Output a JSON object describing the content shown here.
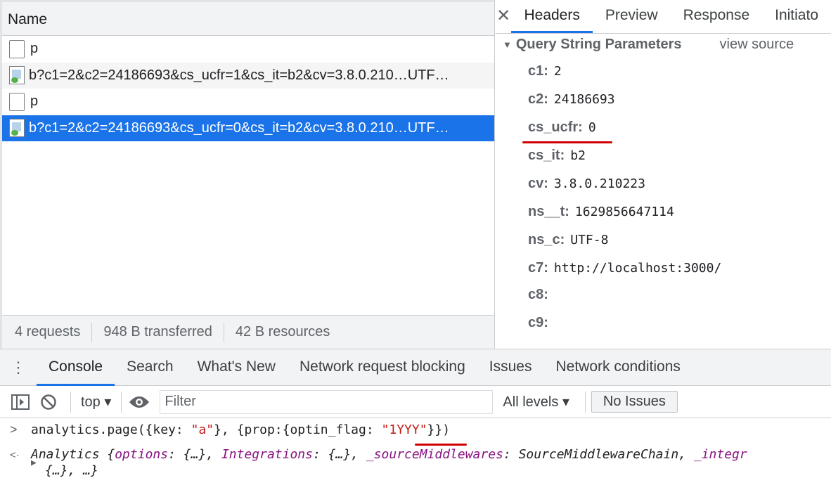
{
  "network": {
    "name_header": "Name",
    "requests": [
      {
        "name": "p",
        "type": "document"
      },
      {
        "name": "b?c1=2&c2=24186693&cs_ucfr=1&cs_it=b2&cv=3.8.0.210…UTF…",
        "type": "image"
      },
      {
        "name": "p",
        "type": "document"
      },
      {
        "name": "b?c1=2&c2=24186693&cs_ucfr=0&cs_it=b2&cv=3.8.0.210…UTF…",
        "type": "image",
        "selected": true
      }
    ],
    "status": {
      "requests": "4 requests",
      "transferred": "948 B transferred",
      "resources": "42 B resources"
    }
  },
  "details": {
    "close_icon": "close-icon",
    "tabs": [
      "Headers",
      "Preview",
      "Response",
      "Initiato"
    ],
    "active_tab": "Headers",
    "section_title": "Query String Parameters",
    "view_source": "view source",
    "params": [
      {
        "key": "c1:",
        "value": "2"
      },
      {
        "key": "c2:",
        "value": "24186693"
      },
      {
        "key": "cs_ucfr:",
        "value": "0"
      },
      {
        "key": "cs_it:",
        "value": "b2"
      },
      {
        "key": "cv:",
        "value": "3.8.0.210223"
      },
      {
        "key": "ns__t:",
        "value": "1629856647114"
      },
      {
        "key": "ns_c:",
        "value": "UTF-8"
      },
      {
        "key": "c7:",
        "value": "http://localhost:3000/"
      },
      {
        "key": "c8:",
        "value": ""
      },
      {
        "key": "c9:",
        "value": ""
      }
    ]
  },
  "drawer": {
    "tabs": [
      "Console",
      "Search",
      "What's New",
      "Network request blocking",
      "Issues",
      "Network conditions"
    ],
    "active_tab": "Console",
    "toolbar": {
      "context": "top ▾",
      "filter_placeholder": "Filter",
      "levels": "All levels ▾",
      "no_issues": "No Issues"
    },
    "input_line": {
      "prompt": ">",
      "p1": "analytics.page({key: ",
      "s1": "\"a\"",
      "p2": "}, {prop:{optin_flag: ",
      "s2": "\"1YYY\"",
      "p3": "}})"
    },
    "output_line": {
      "prompt": "<·",
      "expand": "▶",
      "text1": "Analytics {",
      "k1": "options",
      "v1": ": {…}, ",
      "k2": "Integrations",
      "v2": ": {…}, ",
      "k3": "_sourceMiddlewares",
      "v3": ": SourceMiddlewareChain, ",
      "k4": "_integr",
      "text2": "{…}, …}"
    }
  },
  "colors": {
    "accent": "#1a73e8",
    "annotation": "#d10000",
    "string": "#c41a16"
  }
}
